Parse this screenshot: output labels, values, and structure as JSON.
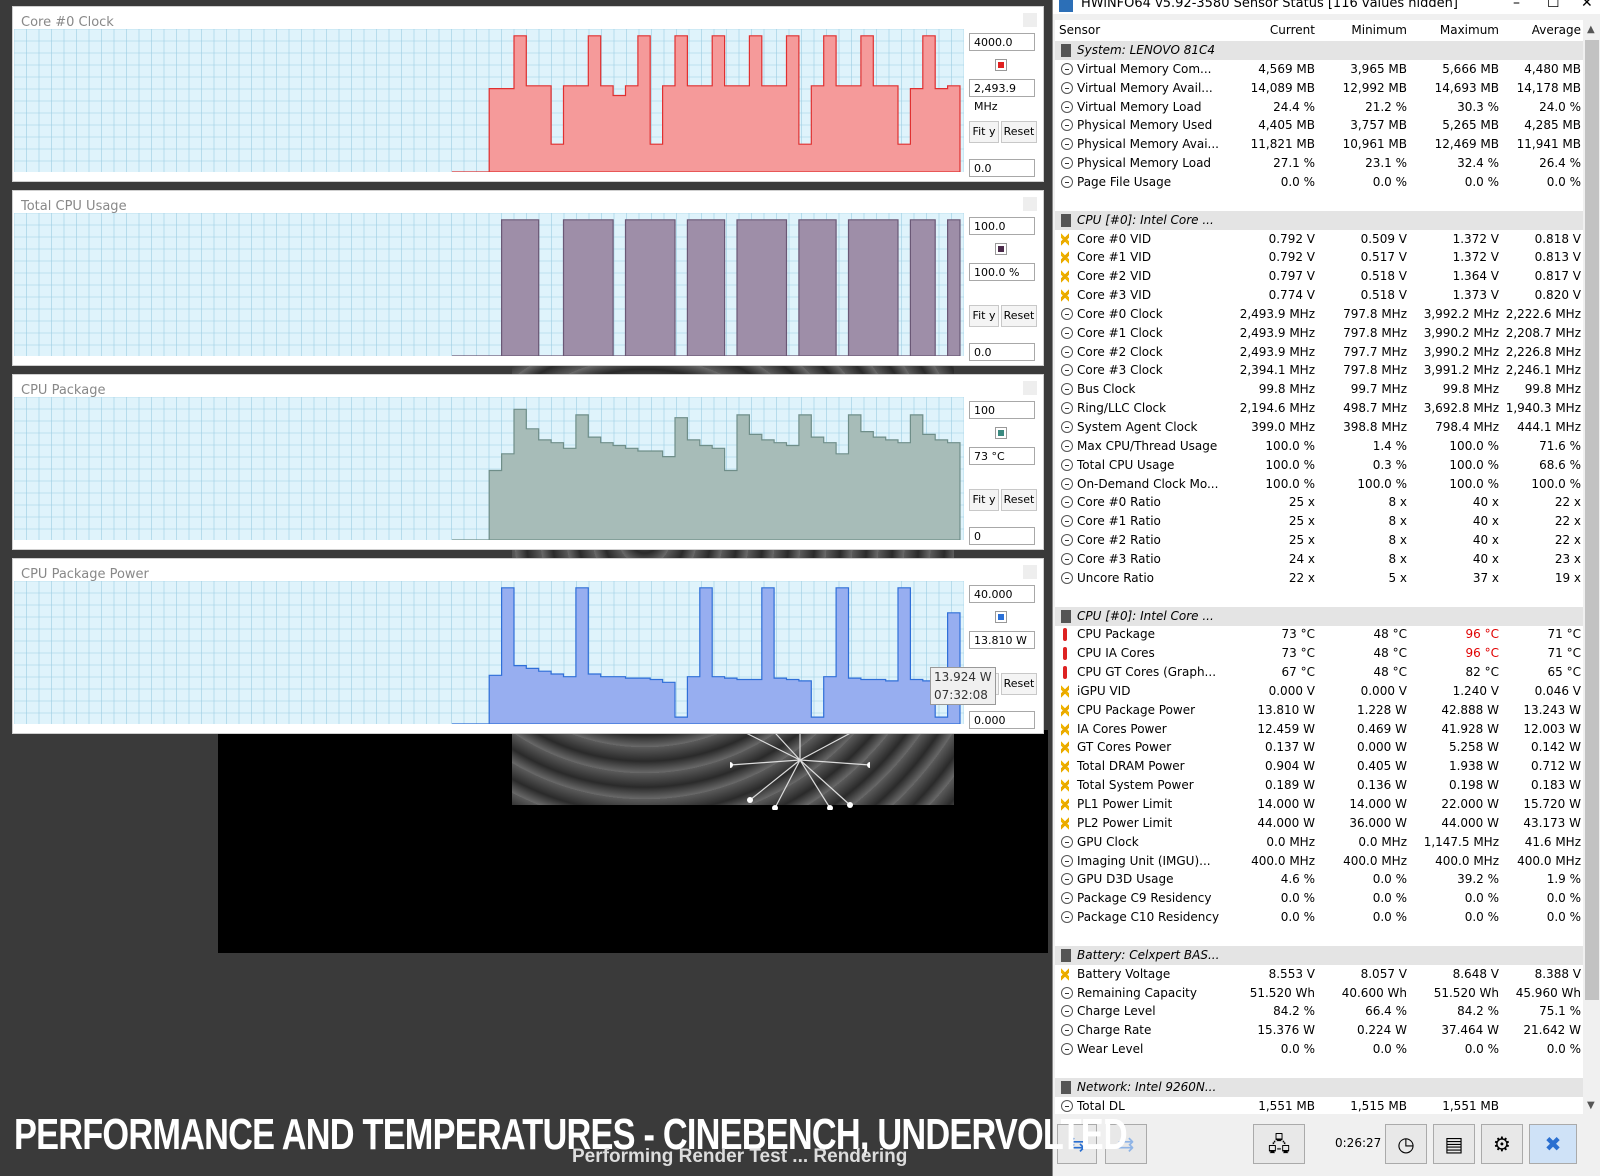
{
  "caption": "PERFORMANCE AND TEMPERATURES - CINEBENCH, UNDERVOLTED",
  "subcaption": "Performing Render Test ... Rendering",
  "graphs": [
    {
      "title": "Core #0 Clock",
      "max": "4000.0",
      "current": "2,493.9 MHz",
      "min": "0.0",
      "fit": "Fit y",
      "reset": "Reset",
      "color": "#f59a9a",
      "line": "#e03030",
      "swatch": "#e02020",
      "profile": [
        0.0,
        0.0,
        0.0,
        0.6,
        0.6,
        0.98,
        0.62,
        0.62,
        0.2,
        0.62,
        0.62,
        0.98,
        0.62,
        0.55,
        0.62,
        0.98,
        0.2,
        0.62,
        0.98,
        0.62,
        0.62,
        0.98,
        0.62,
        0.62,
        0.98,
        0.62,
        0.62,
        0.98,
        0.2,
        0.62,
        0.98,
        0.62,
        0.62,
        0.98,
        0.62,
        0.62,
        0.2,
        0.6,
        0.98,
        0.6,
        0.62,
        0.62
      ]
    },
    {
      "title": "Total CPU Usage",
      "max": "100.0",
      "current": "100.0 %",
      "min": "0.0",
      "fit": "Fit y",
      "reset": "Reset",
      "color": "#9e8ea8",
      "line": "#6a5876",
      "swatch": "#4a2a4a",
      "profile": [
        0.0,
        0.0,
        0.0,
        0.0,
        0.98,
        0.98,
        0.98,
        0.0,
        0.0,
        0.98,
        0.98,
        0.98,
        0.98,
        0.0,
        0.98,
        0.98,
        0.98,
        0.98,
        0.0,
        0.98,
        0.98,
        0.98,
        0.0,
        0.98,
        0.98,
        0.98,
        0.98,
        0.0,
        0.98,
        0.98,
        0.98,
        0.0,
        0.98,
        0.98,
        0.98,
        0.98,
        0.0,
        0.98,
        0.98,
        0.0,
        0.98,
        0.98
      ]
    },
    {
      "title": "CPU Package",
      "max": "100",
      "current": "73 °C",
      "min": "0",
      "fit": "Fit y",
      "reset": "Reset",
      "color": "#a7bcb8",
      "line": "#6f8e89",
      "swatch": "#3a8a80",
      "profile": [
        0.0,
        0.0,
        0.0,
        0.5,
        0.62,
        0.94,
        0.8,
        0.72,
        0.7,
        0.66,
        0.9,
        0.74,
        0.7,
        0.68,
        0.66,
        0.64,
        0.64,
        0.6,
        0.88,
        0.72,
        0.68,
        0.66,
        0.5,
        0.9,
        0.76,
        0.72,
        0.7,
        0.68,
        0.9,
        0.74,
        0.7,
        0.62,
        0.9,
        0.78,
        0.74,
        0.72,
        0.7,
        0.9,
        0.76,
        0.72,
        0.7,
        0.68
      ]
    },
    {
      "title": "CPU Package Power",
      "max": "40.000",
      "current": "13.810 W",
      "min": "0.000",
      "fit": "Fit y",
      "reset": "Reset",
      "color": "#97aef0",
      "line": "#2f6fd8",
      "swatch": "#2a70d8",
      "profile": [
        0.0,
        0.0,
        0.0,
        0.35,
        0.98,
        0.42,
        0.4,
        0.38,
        0.36,
        0.34,
        0.98,
        0.36,
        0.34,
        0.34,
        0.33,
        0.33,
        0.32,
        0.3,
        0.05,
        0.34,
        0.98,
        0.34,
        0.33,
        0.32,
        0.32,
        0.98,
        0.33,
        0.32,
        0.31,
        0.05,
        0.34,
        0.98,
        0.33,
        0.32,
        0.32,
        0.31,
        0.98,
        0.32,
        0.31,
        0.05,
        0.8,
        0.3
      ]
    }
  ],
  "tooltip": {
    "value": "13.924 W",
    "time": "07:32:08"
  },
  "window": {
    "title": "HWiNFO64 v5.92-3580 Sensor Status [116 values hidden]",
    "columns": [
      "Sensor",
      "Current",
      "Minimum",
      "Maximum",
      "Average"
    ],
    "rows": [
      {
        "t": "group",
        "label": "System: LENOVO 81C4"
      },
      {
        "i": "clock",
        "label": "Virtual Memory Com...",
        "v": [
          "4,569 MB",
          "3,965 MB",
          "5,666 MB",
          "4,480 MB"
        ]
      },
      {
        "i": "clock",
        "label": "Virtual Memory Avail...",
        "v": [
          "14,089 MB",
          "12,992 MB",
          "14,693 MB",
          "14,178 MB"
        ]
      },
      {
        "i": "clock",
        "label": "Virtual Memory Load",
        "v": [
          "24.4 %",
          "21.2 %",
          "30.3 %",
          "24.0 %"
        ]
      },
      {
        "i": "clock",
        "label": "Physical Memory Used",
        "v": [
          "4,405 MB",
          "3,757 MB",
          "5,265 MB",
          "4,285 MB"
        ]
      },
      {
        "i": "clock",
        "label": "Physical Memory Avai...",
        "v": [
          "11,821 MB",
          "10,961 MB",
          "12,469 MB",
          "11,941 MB"
        ]
      },
      {
        "i": "clock",
        "label": "Physical Memory Load",
        "v": [
          "27.1 %",
          "23.1 %",
          "32.4 %",
          "26.4 %"
        ]
      },
      {
        "i": "clock",
        "label": "Page File Usage",
        "v": [
          "0.0 %",
          "0.0 %",
          "0.0 %",
          "0.0 %"
        ]
      },
      {
        "t": "blank"
      },
      {
        "t": "group",
        "label": "CPU [#0]: Intel Core ..."
      },
      {
        "i": "volt",
        "label": "Core #0 VID",
        "v": [
          "0.792 V",
          "0.509 V",
          "1.372 V",
          "0.818 V"
        ]
      },
      {
        "i": "volt",
        "label": "Core #1 VID",
        "v": [
          "0.792 V",
          "0.517 V",
          "1.372 V",
          "0.813 V"
        ]
      },
      {
        "i": "volt",
        "label": "Core #2 VID",
        "v": [
          "0.797 V",
          "0.518 V",
          "1.364 V",
          "0.817 V"
        ]
      },
      {
        "i": "volt",
        "label": "Core #3 VID",
        "v": [
          "0.774 V",
          "0.518 V",
          "1.373 V",
          "0.820 V"
        ]
      },
      {
        "i": "clock",
        "label": "Core #0 Clock",
        "v": [
          "2,493.9 MHz",
          "797.8 MHz",
          "3,992.2 MHz",
          "2,222.6 MHz"
        ]
      },
      {
        "i": "clock",
        "label": "Core #1 Clock",
        "v": [
          "2,493.9 MHz",
          "797.8 MHz",
          "3,990.2 MHz",
          "2,208.7 MHz"
        ]
      },
      {
        "i": "clock",
        "label": "Core #2 Clock",
        "v": [
          "2,493.9 MHz",
          "797.7 MHz",
          "3,990.2 MHz",
          "2,226.8 MHz"
        ]
      },
      {
        "i": "clock",
        "label": "Core #3 Clock",
        "v": [
          "2,394.1 MHz",
          "797.8 MHz",
          "3,991.2 MHz",
          "2,246.1 MHz"
        ]
      },
      {
        "i": "clock",
        "label": "Bus Clock",
        "v": [
          "99.8 MHz",
          "99.7 MHz",
          "99.8 MHz",
          "99.8 MHz"
        ]
      },
      {
        "i": "clock",
        "label": "Ring/LLC Clock",
        "v": [
          "2,194.6 MHz",
          "498.7 MHz",
          "3,692.8 MHz",
          "1,940.3 MHz"
        ]
      },
      {
        "i": "clock",
        "label": "System Agent Clock",
        "v": [
          "399.0 MHz",
          "398.8 MHz",
          "798.4 MHz",
          "444.1 MHz"
        ]
      },
      {
        "i": "clock",
        "label": "Max CPU/Thread Usage",
        "v": [
          "100.0 %",
          "1.4 %",
          "100.0 %",
          "71.6 %"
        ]
      },
      {
        "i": "clock",
        "label": "Total CPU Usage",
        "v": [
          "100.0 %",
          "0.3 %",
          "100.0 %",
          "68.6 %"
        ]
      },
      {
        "i": "clock",
        "label": "On-Demand Clock Mo...",
        "v": [
          "100.0 %",
          "100.0 %",
          "100.0 %",
          "100.0 %"
        ]
      },
      {
        "i": "clock",
        "label": "Core #0 Ratio",
        "v": [
          "25 x",
          "8 x",
          "40 x",
          "22 x"
        ]
      },
      {
        "i": "clock",
        "label": "Core #1 Ratio",
        "v": [
          "25 x",
          "8 x",
          "40 x",
          "22 x"
        ]
      },
      {
        "i": "clock",
        "label": "Core #2 Ratio",
        "v": [
          "25 x",
          "8 x",
          "40 x",
          "22 x"
        ]
      },
      {
        "i": "clock",
        "label": "Core #3 Ratio",
        "v": [
          "24 x",
          "8 x",
          "40 x",
          "23 x"
        ]
      },
      {
        "i": "clock",
        "label": "Uncore Ratio",
        "v": [
          "22 x",
          "5 x",
          "37 x",
          "19 x"
        ]
      },
      {
        "t": "blank"
      },
      {
        "t": "group",
        "label": "CPU [#0]: Intel Core ..."
      },
      {
        "i": "temp",
        "label": "CPU Package",
        "v": [
          "73 °C",
          "48 °C",
          "96 °C",
          "71 °C"
        ],
        "redmax": true
      },
      {
        "i": "temp",
        "label": "CPU IA Cores",
        "v": [
          "73 °C",
          "48 °C",
          "96 °C",
          "71 °C"
        ],
        "redmax": true
      },
      {
        "i": "temp",
        "label": "CPU GT Cores (Graph...",
        "v": [
          "67 °C",
          "48 °C",
          "82 °C",
          "65 °C"
        ]
      },
      {
        "i": "volt",
        "label": "iGPU VID",
        "v": [
          "0.000 V",
          "0.000 V",
          "1.240 V",
          "0.046 V"
        ]
      },
      {
        "i": "volt",
        "label": "CPU Package Power",
        "v": [
          "13.810 W",
          "1.228 W",
          "42.888 W",
          "13.243 W"
        ]
      },
      {
        "i": "volt",
        "label": "IA Cores Power",
        "v": [
          "12.459 W",
          "0.469 W",
          "41.928 W",
          "12.003 W"
        ]
      },
      {
        "i": "volt",
        "label": "GT Cores Power",
        "v": [
          "0.137 W",
          "0.000 W",
          "5.258 W",
          "0.142 W"
        ]
      },
      {
        "i": "volt",
        "label": "Total DRAM Power",
        "v": [
          "0.904 W",
          "0.405 W",
          "1.938 W",
          "0.712 W"
        ]
      },
      {
        "i": "volt",
        "label": "Total System Power",
        "v": [
          "0.189 W",
          "0.136 W",
          "0.198 W",
          "0.183 W"
        ]
      },
      {
        "i": "volt",
        "label": "PL1 Power Limit",
        "v": [
          "14.000 W",
          "14.000 W",
          "22.000 W",
          "15.720 W"
        ]
      },
      {
        "i": "volt",
        "label": "PL2 Power Limit",
        "v": [
          "44.000 W",
          "36.000 W",
          "44.000 W",
          "43.173 W"
        ]
      },
      {
        "i": "clock",
        "label": "GPU Clock",
        "v": [
          "0.0 MHz",
          "0.0 MHz",
          "1,147.5 MHz",
          "41.6 MHz"
        ]
      },
      {
        "i": "clock",
        "label": "Imaging Unit (IMGU)...",
        "v": [
          "400.0 MHz",
          "400.0 MHz",
          "400.0 MHz",
          "400.0 MHz"
        ]
      },
      {
        "i": "clock",
        "label": "GPU D3D Usage",
        "v": [
          "4.6 %",
          "0.0 %",
          "39.2 %",
          "1.9 %"
        ]
      },
      {
        "i": "clock",
        "label": "Package C9 Residency",
        "v": [
          "0.0 %",
          "0.0 %",
          "0.0 %",
          "0.0 %"
        ]
      },
      {
        "i": "clock",
        "label": "Package C10 Residency",
        "v": [
          "0.0 %",
          "0.0 %",
          "0.0 %",
          "0.0 %"
        ]
      },
      {
        "t": "blank"
      },
      {
        "t": "group",
        "label": "Battery: Celxpert BAS..."
      },
      {
        "i": "volt",
        "label": "Battery Voltage",
        "v": [
          "8.553 V",
          "8.057 V",
          "8.648 V",
          "8.388 V"
        ]
      },
      {
        "i": "clock",
        "label": "Remaining Capacity",
        "v": [
          "51.520 Wh",
          "40.600 Wh",
          "51.520 Wh",
          "45.960 Wh"
        ]
      },
      {
        "i": "clock",
        "label": "Charge Level",
        "v": [
          "84.2 %",
          "66.4 %",
          "84.2 %",
          "75.1 %"
        ]
      },
      {
        "i": "clock",
        "label": "Charge Rate",
        "v": [
          "15.376 W",
          "0.224 W",
          "37.464 W",
          "21.642 W"
        ]
      },
      {
        "i": "clock",
        "label": "Wear Level",
        "v": [
          "0.0 %",
          "0.0 %",
          "0.0 %",
          "0.0 %"
        ]
      },
      {
        "t": "blank"
      },
      {
        "t": "group",
        "label": "Network: Intel 9260N..."
      },
      {
        "i": "clock",
        "label": "Total DL",
        "v": [
          "1,551 MB",
          "1,515 MB",
          "1,551 MB",
          ""
        ]
      }
    ],
    "elapsed": "0:26:27"
  }
}
